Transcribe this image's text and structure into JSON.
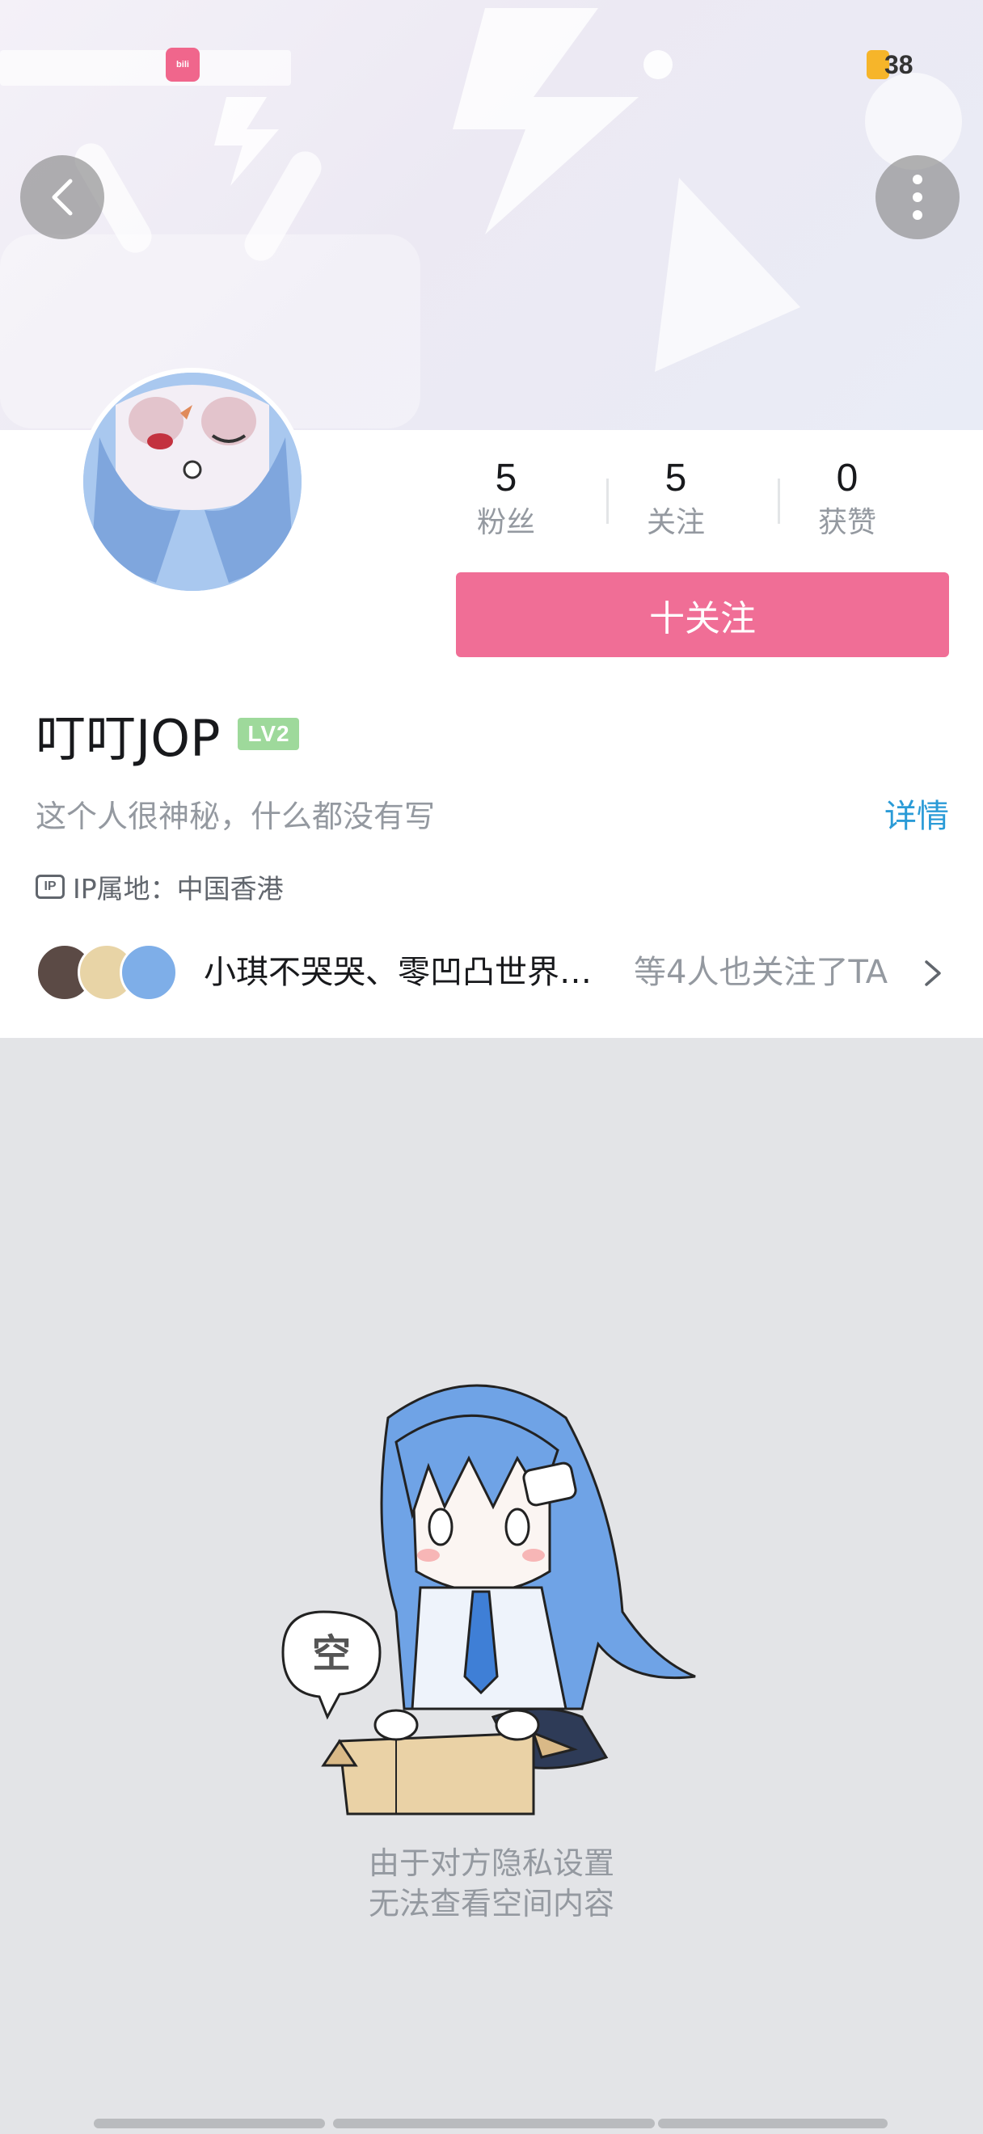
{
  "status_bar": {
    "notification_count": "38"
  },
  "nav": {
    "back_icon": "chevron-left-icon",
    "more_icon": "vertical-dots-icon"
  },
  "user": {
    "name": "叮叮JOP",
    "level": "LV2",
    "signature": "这个人很神秘，什么都没有写",
    "details_label": "详情",
    "ip_badge": "IP",
    "ip_location": "IP属地：中国香港"
  },
  "stats": [
    {
      "value": "5",
      "label": "粉丝"
    },
    {
      "value": "5",
      "label": "关注"
    },
    {
      "value": "0",
      "label": "获赞"
    }
  ],
  "follow_button": {
    "label": "十关注"
  },
  "mutual": {
    "names": "小琪不哭哭、零凹凸世界…",
    "suffix": "等4人也关注了TA"
  },
  "empty_state": {
    "bubble_text": "空",
    "line1": "由于对方隐私设置",
    "line2": "无法查看空间内容"
  },
  "colors": {
    "accent_pink": "#f06e96",
    "link_blue": "#2a9bd7",
    "level_green": "#9ed99b",
    "background": "#e3e4e7"
  }
}
